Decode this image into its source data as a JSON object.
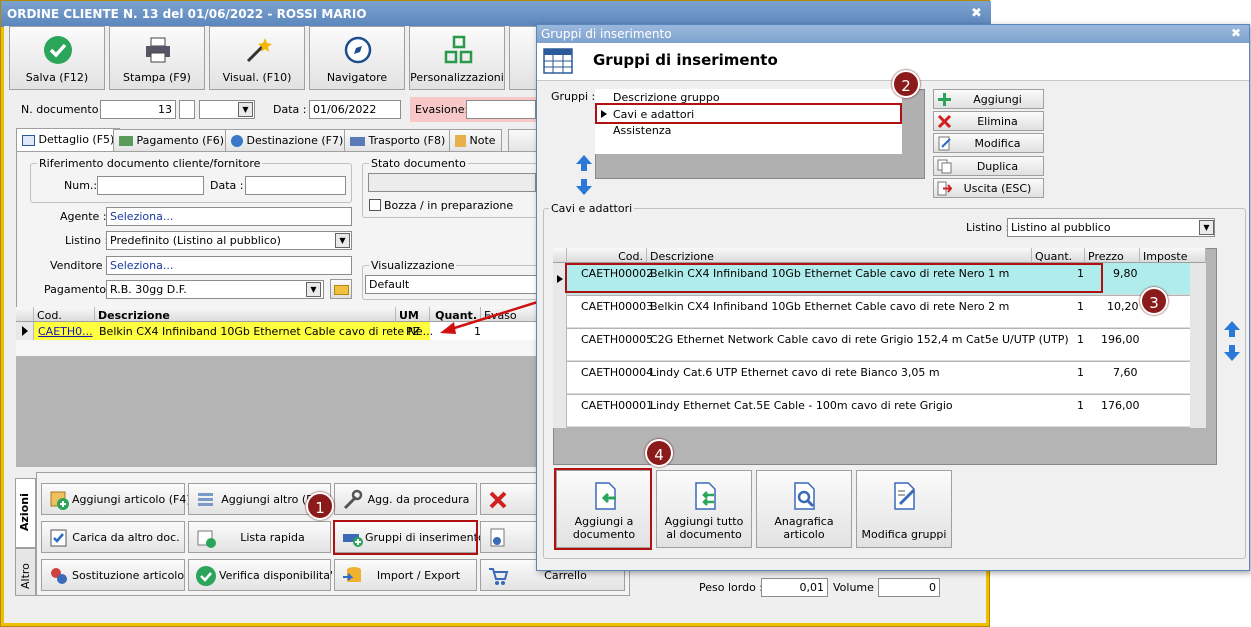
{
  "main": {
    "title": "ORDINE CLIENTE N. 13 del 01/06/2022 - ROSSI MARIO",
    "toolbar": [
      {
        "label": "Salva (F12)",
        "icon": "check-icon"
      },
      {
        "label": "Stampa (F9)",
        "icon": "printer-icon"
      },
      {
        "label": "Visual. (F10)",
        "icon": "magic-wand-icon"
      },
      {
        "label": "Navigatore",
        "icon": "compass-icon"
      },
      {
        "label": "Personalizzazioni",
        "icon": "grid-icon"
      }
    ],
    "header": {
      "ndoc_label": "N. documento :",
      "ndoc_value": "13",
      "data_label": "Data :",
      "data_value": "01/06/2022",
      "evasione_label": "Evasione:"
    },
    "tabs": [
      "Dettaglio (F5)",
      "Pagamento (F6)",
      "Destinazione (F7)",
      "Trasporto (F8)",
      "Note"
    ],
    "rif": {
      "legend": "Riferimento documento cliente/fornitore",
      "num_label": "Num.:",
      "data_label": "Data :"
    },
    "stato": {
      "legend": "Stato documento",
      "bozza_label": "Bozza / in preparazione"
    },
    "agente_label": "Agente :",
    "agente_value": "Seleziona...",
    "listino_label": "Listino :",
    "listino_value": "Predefinito (Listino al pubblico)",
    "venditore_label": "Venditore :",
    "venditore_value": "Seleziona...",
    "pagamento_label": "Pagamento :",
    "pagamento_value": "R.B. 30gg D.F.",
    "visualizzazione_legend": "Visualizzazione",
    "visualizzazione_value": "Default",
    "grid": {
      "headers": [
        "Cod.",
        "Descrizione",
        "UM",
        "Quant.",
        "Evaso"
      ],
      "row": {
        "cod": "CAETH0...",
        "desc": "Belkin CX4 Infiniband 10Gb Ethernet Cable cavo di rete Ne...",
        "um": "PZ",
        "quant": "1"
      }
    },
    "side_tabs": [
      "Azioni",
      "Altro"
    ],
    "actions": [
      {
        "label": "Aggiungi articolo (F4)",
        "icon": "add-article-icon"
      },
      {
        "label": "Aggiungi altro (F2)",
        "icon": "add-other-icon"
      },
      {
        "label": "Agg. da procedura",
        "icon": "wrench-icon"
      },
      {
        "label": "Carica da altro doc.",
        "icon": "load-doc-icon"
      },
      {
        "label": "Lista rapida",
        "icon": "quick-list-icon"
      },
      {
        "label": "Gruppi di inserimento",
        "icon": "insert-group-icon"
      },
      {
        "label": "Sostituzione articolo",
        "icon": "replace-icon"
      },
      {
        "label": "Verifica disponibilita'",
        "icon": "check-icon"
      },
      {
        "label": "Import / Export",
        "icon": "import-export-icon"
      },
      {
        "label": "Carrello",
        "icon": "cart-icon"
      }
    ],
    "peso_label": "Peso lordo :",
    "peso_value": "0,01",
    "volume_label": "Volume :",
    "volume_value": "0"
  },
  "dialog": {
    "title": "Gruppi di inserimento",
    "heading": "Gruppi di inserimento",
    "gruppi_label": "Gruppi :",
    "gruppi_header": "Descrizione gruppo",
    "groups": [
      "Cavi e adattori",
      "Assistenza"
    ],
    "side_buttons": [
      {
        "label": "Aggiungi",
        "icon": "plus-icon"
      },
      {
        "label": "Elimina",
        "icon": "delete-icon"
      },
      {
        "label": "Modifica",
        "icon": "edit-icon"
      },
      {
        "label": "Duplica",
        "icon": "duplicate-icon"
      },
      {
        "label": "Uscita (ESC)",
        "icon": "exit-icon"
      }
    ],
    "section_legend": "Cavi e adattori",
    "listino_label": "Listino :",
    "listino_value": "Listino al pubblico",
    "grid_headers": [
      "Cod.",
      "Descrizione",
      "Quant.",
      "Prezzo",
      "Imposte"
    ],
    "rows": [
      {
        "cod": "CAETH00002",
        "desc": "Belkin CX4 Infiniband 10Gb Ethernet Cable cavo di rete Nero 1 m",
        "quant": "1",
        "prezzo": "9,80"
      },
      {
        "cod": "CAETH00003",
        "desc": "Belkin CX4 Infiniband 10Gb Ethernet Cable cavo di rete Nero 2 m",
        "quant": "1",
        "prezzo": "10,20"
      },
      {
        "cod": "CAETH00005",
        "desc": "C2G Ethernet Network Cable cavo di rete Grigio 152,4 m Cat5e U/UTP (UTP)",
        "quant": "1",
        "prezzo": "196,00"
      },
      {
        "cod": "CAETH00004",
        "desc": "Lindy Cat.6 UTP Ethernet cavo di rete Bianco 3,05 m",
        "quant": "1",
        "prezzo": "7,60"
      },
      {
        "cod": "CAETH00001",
        "desc": "Lindy Ethernet Cat.5E Cable - 100m cavo di rete Grigio",
        "quant": "1",
        "prezzo": "176,00"
      }
    ],
    "bottom_buttons": [
      {
        "label": "Aggiungi a documento",
        "icon": "add-to-doc-icon"
      },
      {
        "label": "Aggiungi tutto al documento",
        "icon": "add-all-icon"
      },
      {
        "label": "Anagrafica articolo",
        "icon": "search-article-icon"
      },
      {
        "label": "Modifica gruppi",
        "icon": "edit-groups-icon"
      }
    ]
  },
  "callouts": [
    "1",
    "2",
    "3",
    "4"
  ],
  "colors": {
    "accent": "#f0c000",
    "title": "#5a86bd",
    "highlight": "#b0ecec",
    "yellow": "#ffff40",
    "red": "#b01010"
  }
}
